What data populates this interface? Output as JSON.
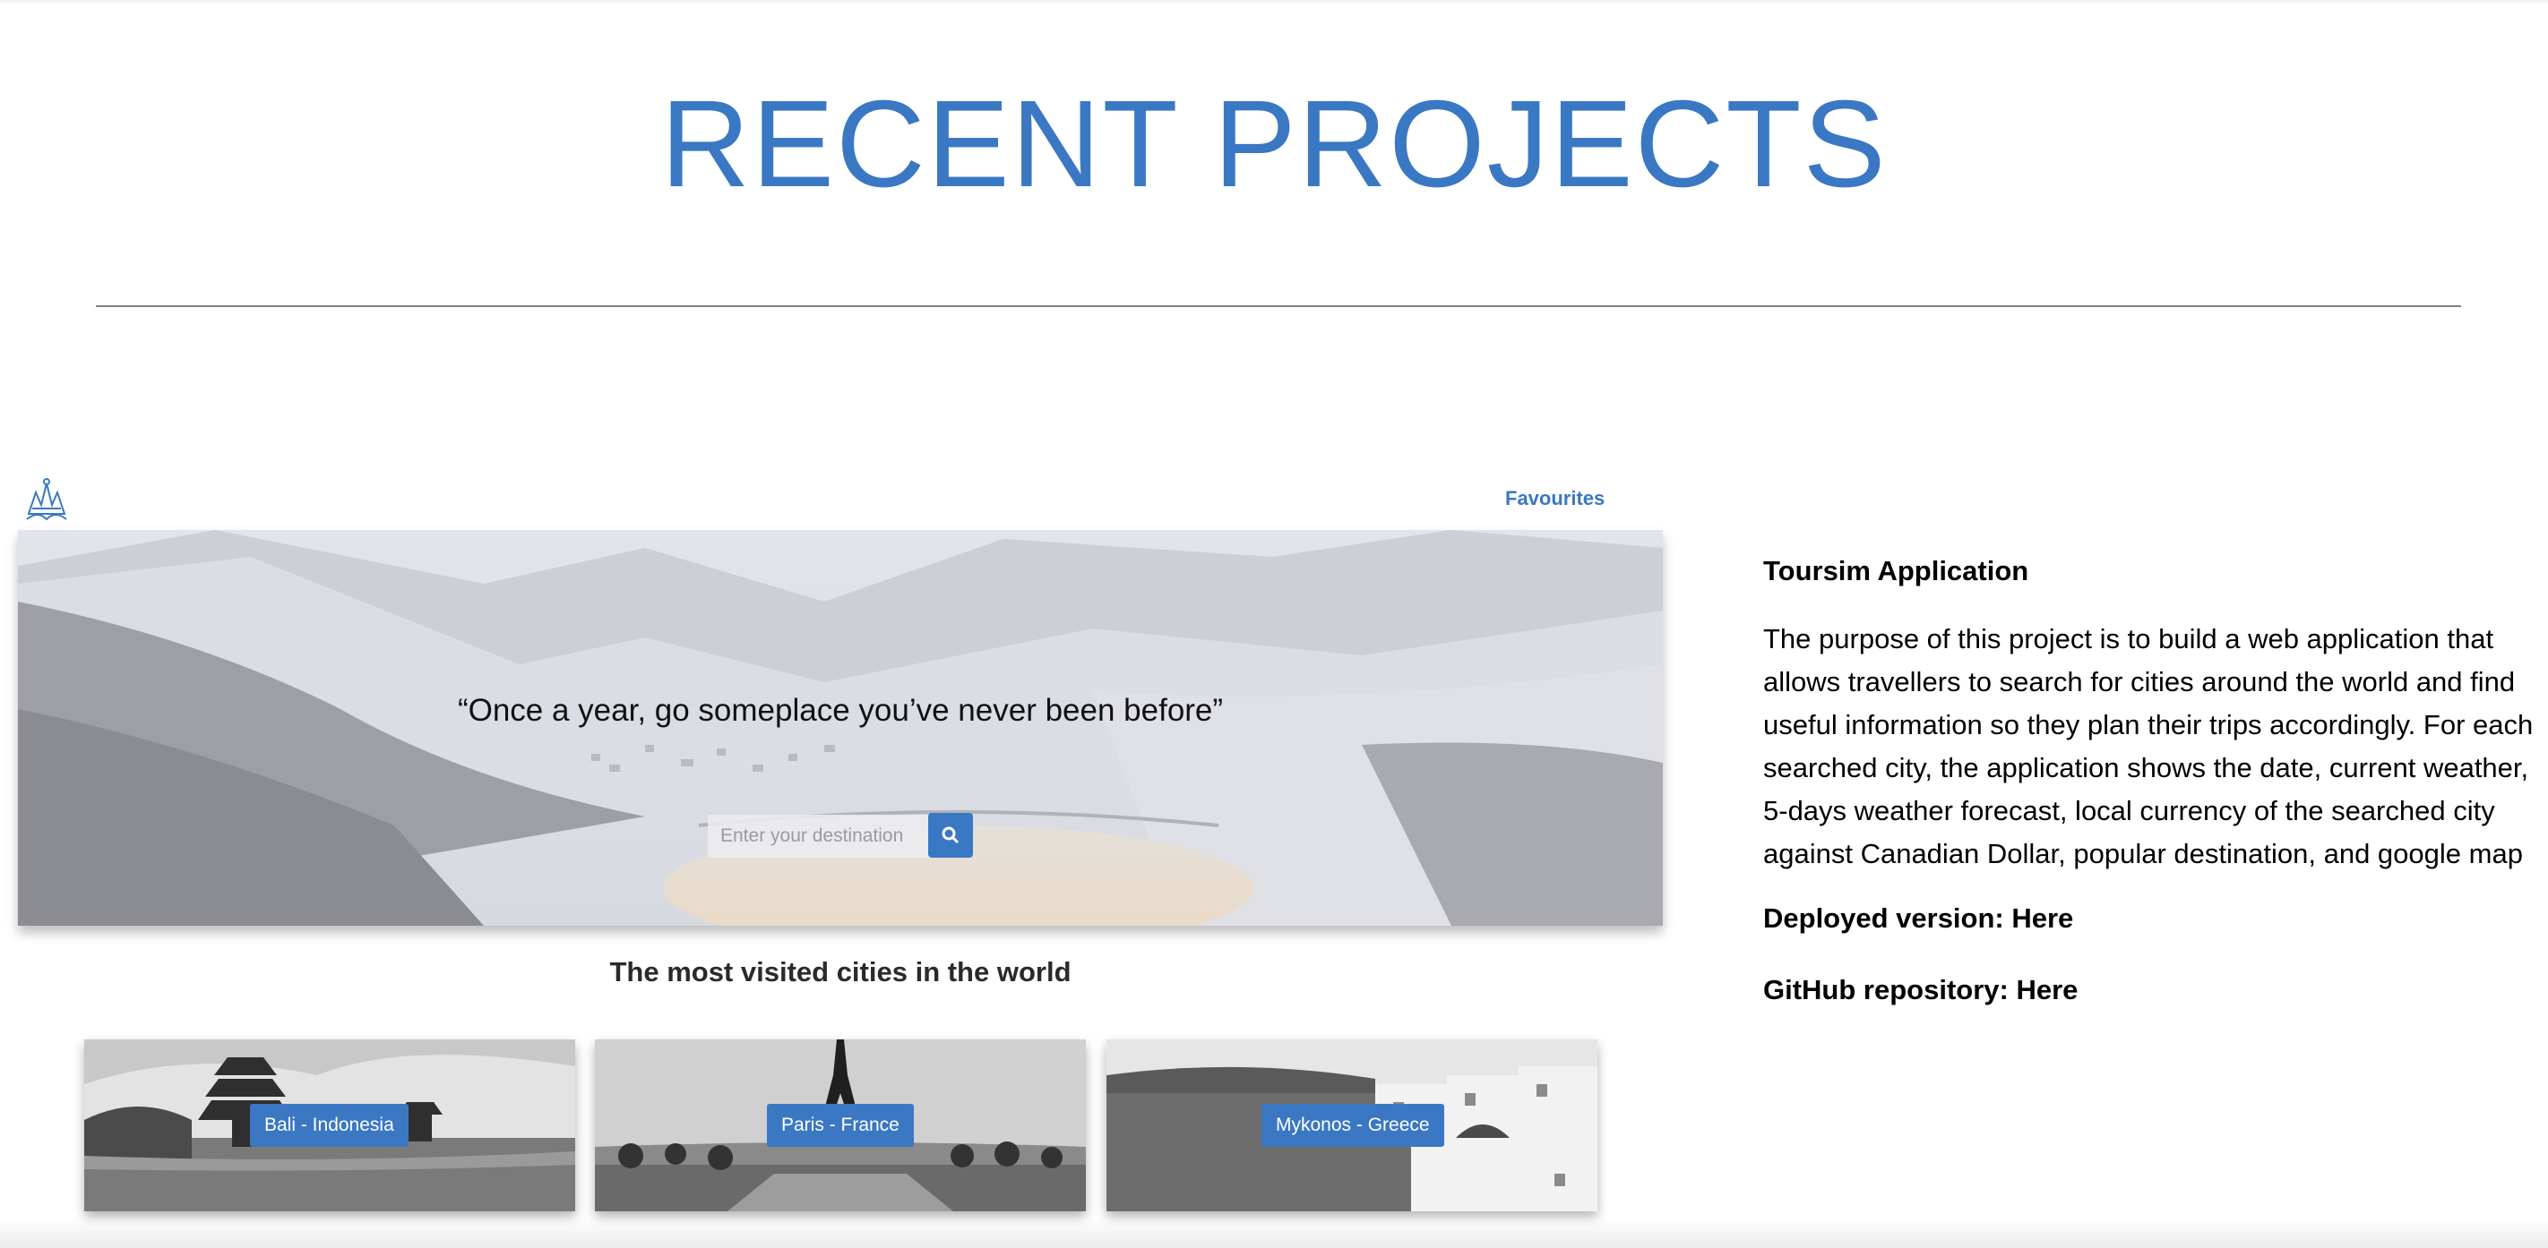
{
  "page": {
    "title": "RECENT PROJECTS"
  },
  "project": {
    "nav": {
      "favourites_label": "Favourites"
    },
    "hero": {
      "quote": "“Once a year, go someplace you’ve never been before”",
      "search_placeholder": "Enter your destination"
    },
    "section_heading": "The most visited cities in the world",
    "cities": [
      {
        "label": "Bali - Indonesia"
      },
      {
        "label": "Paris - France"
      },
      {
        "label": "Mykonos - Greece"
      }
    ]
  },
  "description": {
    "title": "Toursim Application",
    "body": "The purpose of this project is to build a web application that allows travellers to search for cities around the world and find useful information so they plan their trips accordingly. For each searched city, the application shows the date, current weather, 5-days weather forecast, local currency of the searched city against Canadian Dollar, popular destination, and google map",
    "deployed_label": "Deployed version:",
    "deployed_link": "Here",
    "github_label": "GitHub repository:",
    "github_link": "Here"
  },
  "colors": {
    "accent": "#3a78c3",
    "divider": "#808080"
  },
  "icons": [
    "logo-icon",
    "search-icon"
  ]
}
